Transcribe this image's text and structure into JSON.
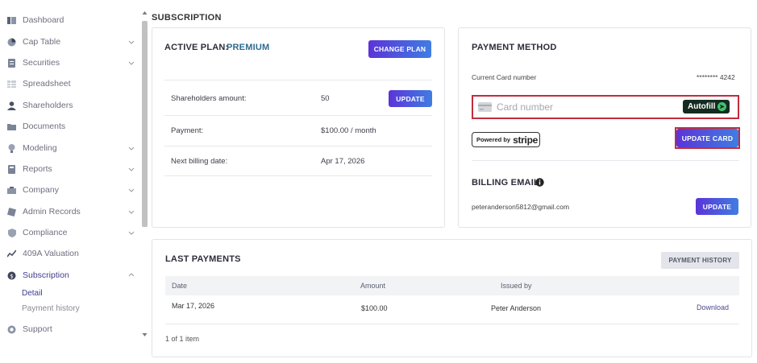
{
  "sidebar": {
    "items": [
      {
        "label": "Dashboard",
        "icon": "dashboard-icon",
        "has_chevron": false
      },
      {
        "label": "Cap Table",
        "icon": "pie-chart-icon",
        "has_chevron": true
      },
      {
        "label": "Securities",
        "icon": "document-icon",
        "has_chevron": true
      },
      {
        "label": "Spreadsheet",
        "icon": "spreadsheet-icon",
        "has_chevron": false
      },
      {
        "label": "Shareholders",
        "icon": "user-icon",
        "has_chevron": false
      },
      {
        "label": "Documents",
        "icon": "folder-icon",
        "has_chevron": false
      },
      {
        "label": "Modeling",
        "icon": "lightbulb-icon",
        "has_chevron": true
      },
      {
        "label": "Reports",
        "icon": "report-icon",
        "has_chevron": true
      },
      {
        "label": "Company",
        "icon": "building-icon",
        "has_chevron": true
      },
      {
        "label": "Admin Records",
        "icon": "records-icon",
        "has_chevron": true
      },
      {
        "label": "Compliance",
        "icon": "shield-icon",
        "has_chevron": true
      },
      {
        "label": "409A Valuation",
        "icon": "valuation-icon",
        "has_chevron": false
      },
      {
        "label": "Subscription",
        "icon": "subscription-icon",
        "has_chevron": true,
        "expanded": true
      },
      {
        "label": "Support",
        "icon": "support-icon",
        "has_chevron": false
      }
    ],
    "sub_items": [
      {
        "label": "Detail",
        "active": true
      },
      {
        "label": "Payment history",
        "active": false
      }
    ]
  },
  "page": {
    "title": "SUBSCRIPTION"
  },
  "plan": {
    "label": "ACTIVE PLAN:",
    "name": "PREMIUM",
    "change_button": "CHANGE PLAN",
    "rows": [
      {
        "label": "Shareholders amount:",
        "value": "50",
        "button": "UPDATE"
      },
      {
        "label": "Payment:",
        "value": "$100.00 / month"
      },
      {
        "label": "Next billing date:",
        "value": "Apr 17, 2026"
      }
    ]
  },
  "payment_method": {
    "title": "PAYMENT METHOD",
    "current_card_label": "Current Card number",
    "current_card_value": "******** 4242",
    "card_placeholder": "Card number",
    "autofill_label": "Autofill",
    "powered_by": "Powered by",
    "stripe": "stripe",
    "update_card_button": "UPDATE CARD",
    "billing_email_title": "BILLING EMAIL",
    "billing_email_value": "peteranderson5812@gmail.com",
    "billing_update_button": "UPDATE"
  },
  "payments": {
    "title": "LAST PAYMENTS",
    "history_button": "PAYMENT HISTORY",
    "columns": [
      "Date",
      "Amount",
      "Issued by"
    ],
    "rows": [
      {
        "date": "Mar 17, 2026",
        "amount": "$100.00",
        "issued_by": "Peter Anderson",
        "action": "Download"
      }
    ],
    "footer": "1 of 1 item"
  }
}
